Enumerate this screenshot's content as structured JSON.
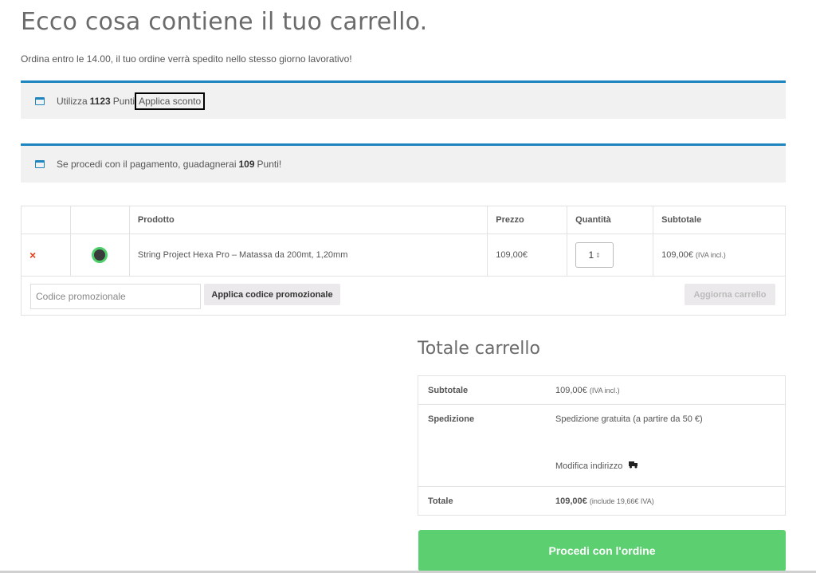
{
  "header": {
    "title": "Ecco cosa contiene il tuo carrello.",
    "subtitle": "Ordina entro le 14.00, il tuo ordine verrà spedito nello stesso giorno lavorativo!"
  },
  "notices": {
    "points_use_prefix": "Utilizza",
    "points_use_amount": "1123",
    "points_use_suffix": "Punti",
    "apply_discount": "Applica sconto",
    "earn_prefix": "Se procedi con il pagamento, guadagnerai",
    "earn_amount": "109",
    "earn_suffix": "Punti!"
  },
  "cart": {
    "columns": [
      "",
      "",
      "Prodotto",
      "Prezzo",
      "Quantità",
      "Subtotale"
    ],
    "items": [
      {
        "remove": "×",
        "product": "String Project Hexa Pro – Matassa da 200mt, 1,20mm",
        "price": "109,00€",
        "quantity": "1",
        "subtotal": "109,00€",
        "subtotal_note": "(IVA incl.)"
      }
    ],
    "coupon_placeholder": "Codice promozionale",
    "coupon_button": "Applica codice promozionale",
    "update_button": "Aggiorna carrello"
  },
  "totals": {
    "title": "Totale carrello",
    "subtotal_label": "Subtotale",
    "subtotal_value": "109,00€",
    "subtotal_note": "(IVA incl.)",
    "shipping_label": "Spedizione",
    "shipping_value": "Spedizione gratuita (a partire da 50 €)",
    "modify_address": "Modifica indirizzo",
    "total_label": "Totale",
    "total_value": "109,00€",
    "total_note": "(include 19,66€ IVA)",
    "checkout_button": "Procedi con l'ordine"
  },
  "colors": {
    "accent": "#1e85be",
    "checkout": "#5ccf70",
    "remove": "#e2401c"
  }
}
